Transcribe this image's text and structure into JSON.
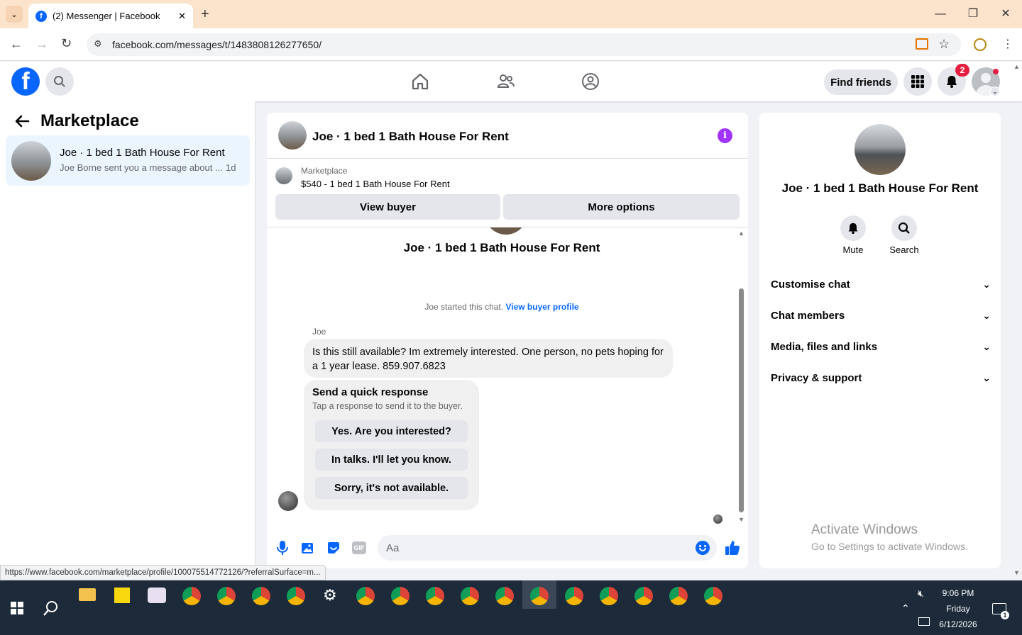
{
  "browser": {
    "tab_title": "(2) Messenger | Facebook",
    "url": "facebook.com/messages/t/1483808126277650/",
    "status_url": "https://www.facebook.com/marketplace/profile/100075514772126/?referralSurface=m..."
  },
  "header": {
    "find_friends": "Find friends",
    "notification_count": "2"
  },
  "left": {
    "title": "Marketplace",
    "conversation": {
      "name": "Joe · 1 bed 1 Bath House For Rent",
      "preview": "Joe Borne sent you a message about ...",
      "time": "1d"
    }
  },
  "chat": {
    "title": "Joe · 1 bed 1 Bath House For Rent",
    "listing_label": "Marketplace",
    "listing_title": "$540 - 1 bed 1 Bath House For Rent",
    "view_buyer": "View buyer",
    "more_options": "More options",
    "intro_name": "Joe · 1 bed 1 Bath House For Rent",
    "started_text": "Joe started this chat.",
    "view_buyer_profile": "View buyer profile",
    "sender": "Joe",
    "message": "Is this still available? Im extremely interested. One person, no pets hoping for a 1 year lease. 859.907.6823",
    "quick_title": "Send a quick response",
    "quick_subtitle": "Tap a response to send it to the buyer.",
    "quick_responses": [
      "Yes. Are you interested?",
      "In talks. I'll let you know.",
      "Sorry, it's not available."
    ],
    "input_placeholder": "Aa"
  },
  "right": {
    "name": "Joe · 1 bed 1 Bath House For Rent",
    "mute": "Mute",
    "search": "Search",
    "sections": [
      "Customise chat",
      "Chat members",
      "Media, files and links",
      "Privacy & support"
    ],
    "activate_title": "Activate Windows",
    "activate_sub": "Go to Settings to activate Windows."
  },
  "taskbar": {
    "time": "9:06 PM",
    "day": "Friday",
    "date": "6/12/2026",
    "notif_count": "1"
  },
  "colors": {
    "fb_blue": "#0866ff",
    "purple_info": "#a033ff",
    "badge_red": "#e41e3f",
    "selected_row": "#ebf5ff"
  }
}
